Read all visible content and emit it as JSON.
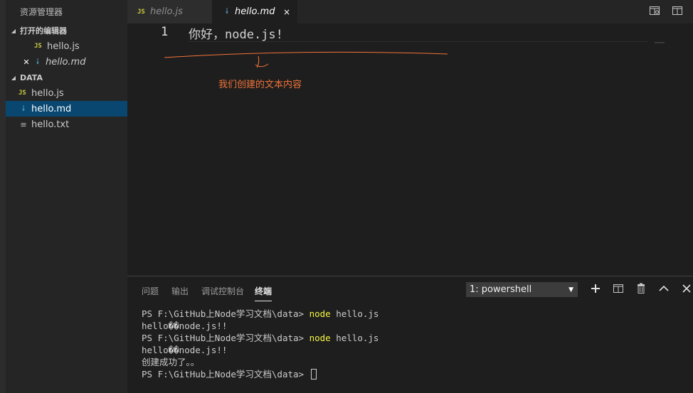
{
  "sidebar": {
    "title": "资源管理器",
    "open_editors": {
      "label": "打开的编辑器",
      "items": [
        {
          "icon": "JS",
          "name": "hello.js"
        },
        {
          "icon": "md",
          "name": "hello.md"
        }
      ]
    },
    "folder": {
      "label": "DATA",
      "items": [
        {
          "icon": "JS",
          "name": "hello.js"
        },
        {
          "icon": "md",
          "name": "hello.md",
          "selected": true
        },
        {
          "icon": "txt",
          "name": "hello.txt"
        }
      ]
    }
  },
  "tabs": [
    {
      "icon": "JS",
      "label": "hello.js",
      "active": false
    },
    {
      "icon": "md",
      "label": "hello.md",
      "active": true,
      "close": "×"
    }
  ],
  "editor": {
    "line_number": "1",
    "line_text": "你好，node.js!",
    "annotation": "我们创建的文本内容",
    "annotation_color": "#f0733a"
  },
  "panel": {
    "tabs": [
      "问题",
      "输出",
      "调试控制台",
      "终端"
    ],
    "active_tab": "终端",
    "terminal_select": "1: powershell",
    "terminal_lines": [
      {
        "prompt": "PS F:\\GitHub上Node学习文档\\data> ",
        "cmd": "node",
        "args": " hello.js"
      },
      {
        "text": "hello��node.js!!"
      },
      {
        "prompt": "PS F:\\GitHub上Node学习文档\\data> ",
        "cmd": "node",
        "args": " hello.js"
      },
      {
        "text": "hello��node.js!!"
      },
      {
        "text": "创建成功了。。"
      },
      {
        "prompt": "PS F:\\GitHub上Node学习文档\\data> ",
        "cursor": true
      }
    ]
  },
  "colors": {
    "accent_selected": "#094771",
    "js_icon": "#cbcb41",
    "md_icon": "#519aba",
    "command": "#f5f543"
  }
}
